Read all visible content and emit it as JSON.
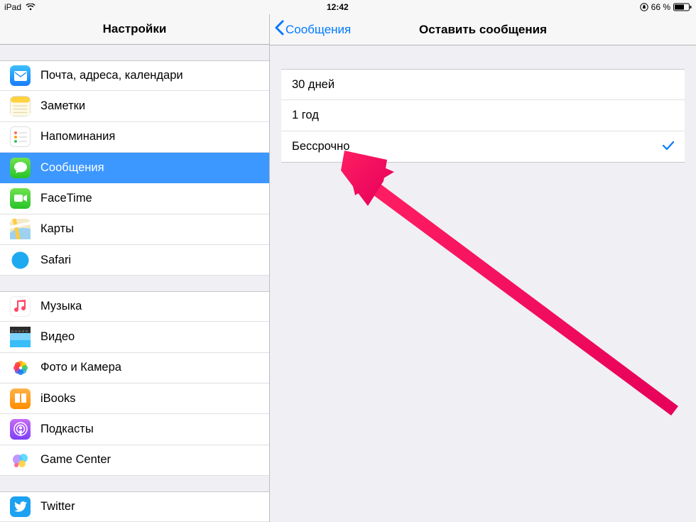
{
  "status": {
    "device": "iPad",
    "time": "12:42",
    "battery_text": "66 %"
  },
  "sidebar": {
    "title": "Настройки",
    "items": [
      {
        "label": "Почта, адреса, календари",
        "icon": "mail"
      },
      {
        "label": "Заметки",
        "icon": "notes"
      },
      {
        "label": "Напоминания",
        "icon": "reminders"
      },
      {
        "label": "Сообщения",
        "icon": "messages",
        "selected": true
      },
      {
        "label": "FaceTime",
        "icon": "facetime"
      },
      {
        "label": "Карты",
        "icon": "maps"
      },
      {
        "label": "Safari",
        "icon": "safari"
      }
    ],
    "items2": [
      {
        "label": "Музыка",
        "icon": "music"
      },
      {
        "label": "Видео",
        "icon": "videos"
      },
      {
        "label": "Фото и Камера",
        "icon": "photos"
      },
      {
        "label": "iBooks",
        "icon": "ibooks"
      },
      {
        "label": "Подкасты",
        "icon": "podcasts"
      },
      {
        "label": "Game Center",
        "icon": "gamecenter"
      }
    ],
    "items3": [
      {
        "label": "Twitter",
        "icon": "twitter"
      }
    ]
  },
  "detail": {
    "back_label": "Сообщения",
    "title": "Оставить сообщения",
    "options": [
      {
        "label": "30 дней",
        "selected": false
      },
      {
        "label": "1 год",
        "selected": false
      },
      {
        "label": "Бессрочно",
        "selected": true
      }
    ]
  },
  "colors": {
    "accent": "#007aff",
    "select_bg": "#3c97ff",
    "arrow": "#ea1e63"
  }
}
